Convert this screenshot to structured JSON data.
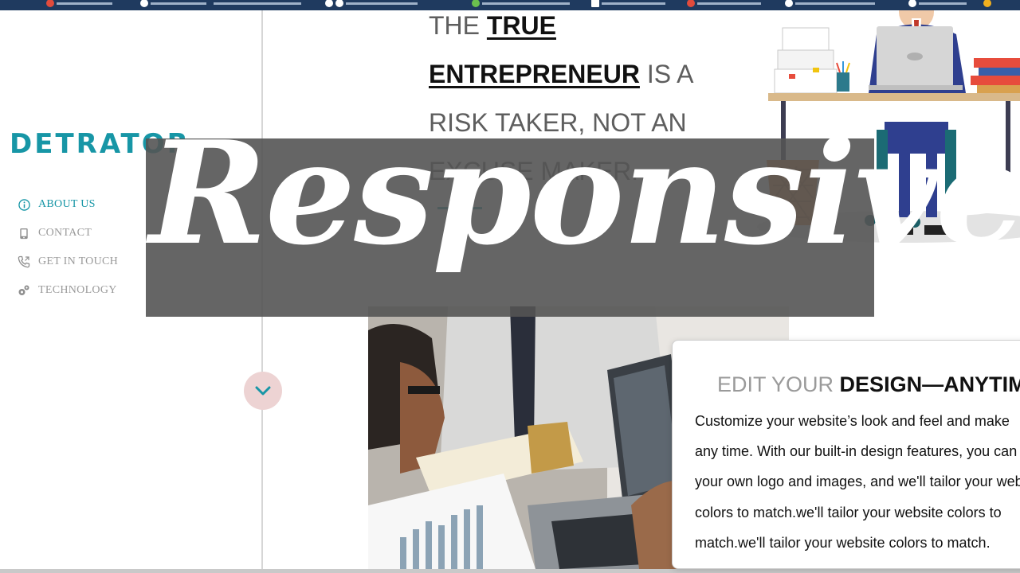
{
  "browser": {
    "bookmarks": [
      {
        "icon": "red-dot-icon"
      },
      {
        "icon": "white-circle-icon"
      },
      {
        "icon": "white-circle-icon"
      },
      {
        "icon": "white-circle-icon"
      },
      {
        "icon": "green-dot-icon"
      },
      {
        "icon": "doc-icon"
      },
      {
        "icon": "red-dot-icon"
      },
      {
        "icon": "white-circle-icon"
      },
      {
        "icon": "person-icon"
      },
      {
        "icon": "yellow-dot-icon"
      }
    ]
  },
  "sidebar": {
    "logo": "DETRATOR",
    "items": [
      {
        "label": "ABOUT US",
        "icon": "info-icon",
        "active": true
      },
      {
        "label": "CONTACT",
        "icon": "mobile-icon",
        "active": false
      },
      {
        "label": "GET IN TOUCH",
        "icon": "phone-icon",
        "active": false
      },
      {
        "label": "TECHNOLOGY",
        "icon": "gears-icon",
        "active": false
      }
    ],
    "scroll_down_icon": "chevron-down-icon"
  },
  "hero": {
    "quote_1": "THE ",
    "quote_2": "TRUE",
    "quote_3": "ENTREPRENEUR",
    "quote_4": " IS A RISK TAKER, NOT AN EXCUSE MAKER."
  },
  "card": {
    "title_light": "EDIT YOUR ",
    "title_bold": "DESIGN—ANYTIME",
    "body_lines": [
      "Customize your website’s look and feel and make",
      "any time. With our built-in design features, you can",
      "your own logo and images, and we'll tailor your website",
      "colors to match.we'll tailor your website colors to",
      "match.we'll tailor your website colors to match."
    ]
  },
  "banner": {
    "text": "Responsive"
  },
  "colors": {
    "accent": "#1796a6",
    "banner_bg": "#545454",
    "down_button_bg": "#edd3d3"
  }
}
